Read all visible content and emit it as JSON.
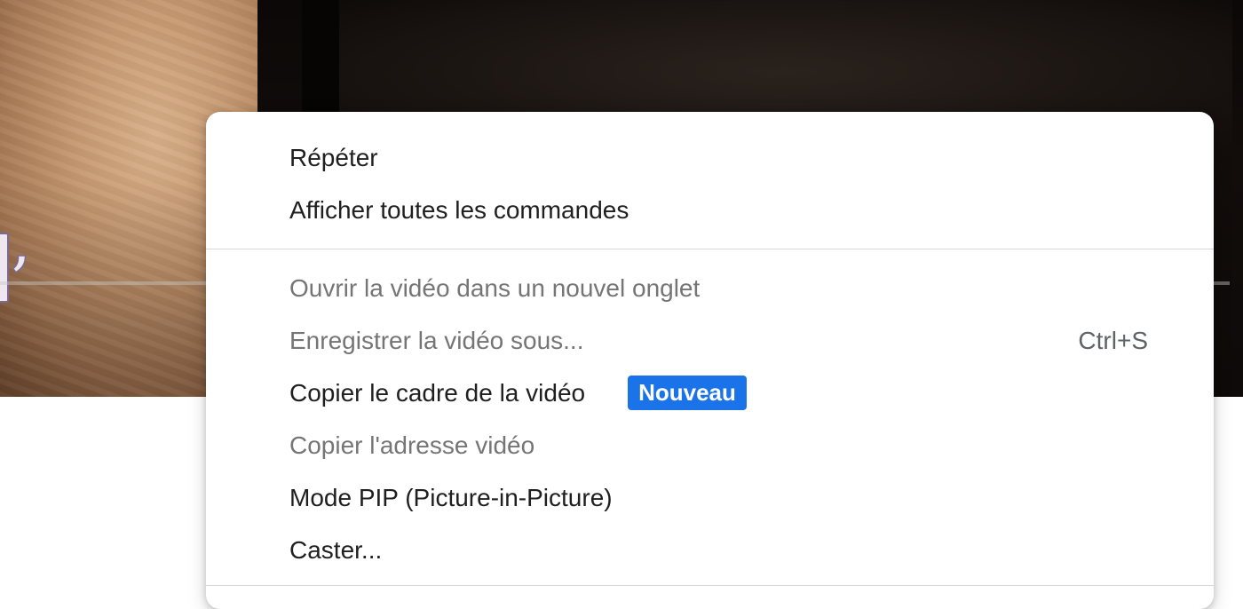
{
  "context_menu": {
    "group1": [
      {
        "label": "Répéter",
        "disabled": false
      },
      {
        "label": "Afficher toutes les commandes",
        "disabled": false
      }
    ],
    "group2": [
      {
        "label": "Ouvrir la vidéo dans un nouvel onglet",
        "disabled": true
      },
      {
        "label": "Enregistrer la vidéo sous...",
        "disabled": true,
        "shortcut": "Ctrl+S"
      },
      {
        "label": "Copier le cadre de la vidéo",
        "disabled": false,
        "badge": "Nouveau"
      },
      {
        "label": "Copier l'adresse vidéo",
        "disabled": true
      },
      {
        "label": "Mode PIP (Picture-in-Picture)",
        "disabled": false
      },
      {
        "label": "Caster...",
        "disabled": false
      }
    ]
  },
  "colors": {
    "badge_bg": "#1a73e8",
    "enabled_text": "#1f1f1f",
    "disabled_text": "#757575"
  }
}
